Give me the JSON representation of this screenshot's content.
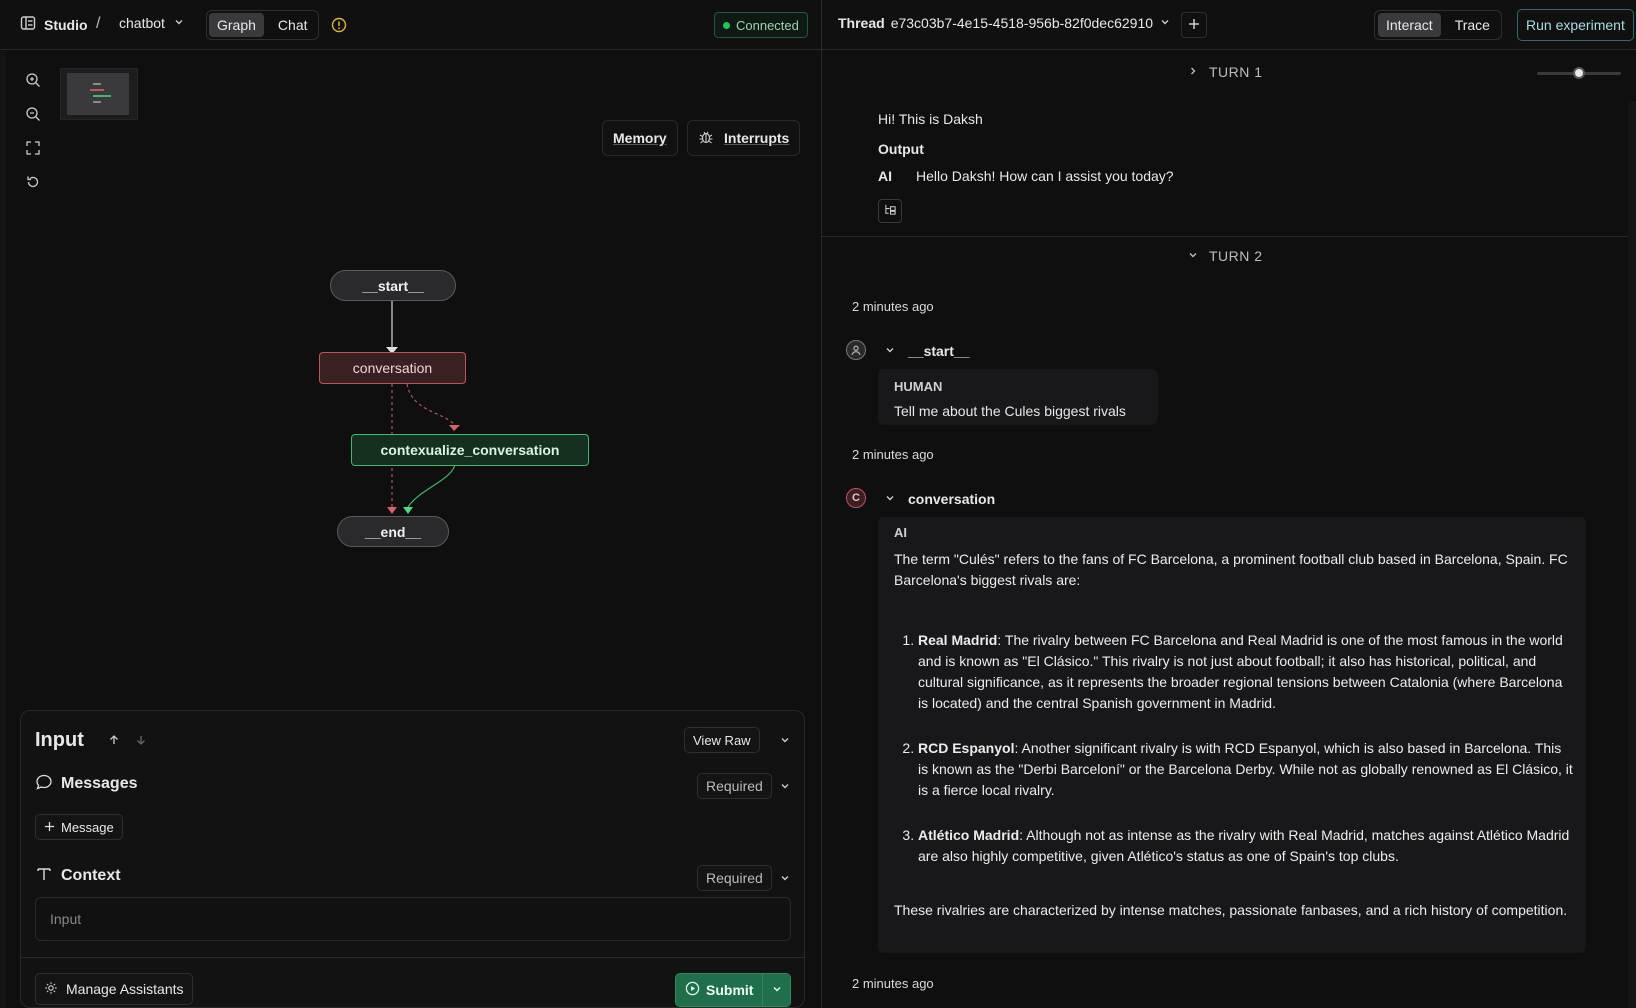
{
  "topbar": {
    "studio_label": "Studio",
    "separator": "/",
    "project_name": "chatbot",
    "view_tabs": [
      "Graph",
      "Chat"
    ],
    "active_tab": "Graph",
    "status": "Connected",
    "status_color": "#22c55e",
    "thread_label": "Thread",
    "thread_id": "e73c03b7-4e15-4518-956b-82f0dec62910",
    "mode_tabs": [
      "Interact",
      "Trace"
    ],
    "active_mode": "Interact",
    "run_experiment_label": "Run experiment"
  },
  "graph": {
    "memory_label": "Memory",
    "interrupts_label": "Interrupts",
    "nodes": {
      "start": "__start__",
      "conversation": "conversation",
      "contextualize": "contexualize_conversation",
      "end": "__end__"
    },
    "colors": {
      "conversation": "#e06c75",
      "contextualize": "#4ade80"
    }
  },
  "input_panel": {
    "title": "Input",
    "view_raw_label": "View Raw",
    "messages_label": "Messages",
    "messages_required": "Required",
    "add_message_label": "Message",
    "context_label": "Context",
    "context_required": "Required",
    "context_placeholder": "Input",
    "manage_assistants_label": "Manage Assistants",
    "submit_label": "Submit",
    "submit_color": "#1f6f4a"
  },
  "thread": {
    "turn1": {
      "label": "TURN 1",
      "human_text": "Hi! This is Daksh",
      "output_label": "Output",
      "ai_label": "AI",
      "ai_text": "Hello Daksh! How can I assist you today?"
    },
    "turn2": {
      "label": "TURN 2",
      "timestamp1": "2 minutes ago",
      "start_node_label": "__start__",
      "human_label": "HUMAN",
      "human_text": "Tell me about the Cules biggest rivals",
      "timestamp2": "2 minutes ago",
      "conversation_node_label": "conversation",
      "conversation_badge": "C",
      "ai_label": "AI",
      "intro": "The term \"Culés\" refers to the fans of FC Barcelona, a prominent football club based in Barcelona, Spain. FC Barcelona's biggest rivals are:",
      "rivals": [
        {
          "name": "Real Madrid",
          "text": ": The rivalry between FC Barcelona and Real Madrid is one of the most famous in the world and is known as \"El Clásico.\" This rivalry is not just about football; it also has historical, political, and cultural significance, as it represents the broader regional tensions between Catalonia (where Barcelona is located) and the central Spanish government in Madrid."
        },
        {
          "name": "RCD Espanyol",
          "text": ": Another significant rivalry is with RCD Espanyol, which is also based in Barcelona. This is known as the \"Derbi Barceloní\" or the Barcelona Derby. While not as globally renowned as El Clásico, it is a fierce local rivalry."
        },
        {
          "name": "Atlético Madrid",
          "text": ": Although not as intense as the rivalry with Real Madrid, matches against Atlético Madrid are also highly competitive, given Atlético's status as one of Spain's top clubs."
        }
      ],
      "outro": "These rivalries are characterized by intense matches, passionate fanbases, and a rich history of competition.",
      "timestamp3": "2 minutes ago"
    }
  }
}
